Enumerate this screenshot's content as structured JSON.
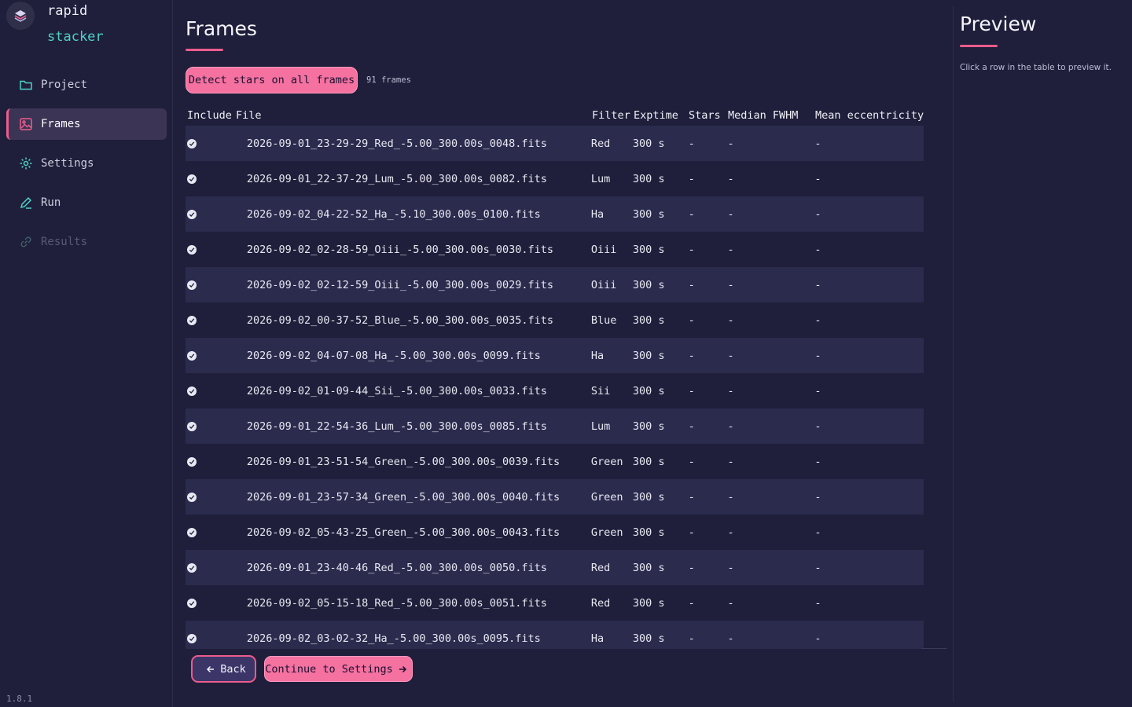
{
  "brand": {
    "line1": "rapid",
    "line2": "stacker"
  },
  "nav": [
    {
      "label": "Project",
      "icon": "folder-icon",
      "state": "normal"
    },
    {
      "label": "Frames",
      "icon": "image-icon",
      "state": "active"
    },
    {
      "label": "Settings",
      "icon": "gear-icon",
      "state": "normal"
    },
    {
      "label": "Run",
      "icon": "pen-icon",
      "state": "normal"
    },
    {
      "label": "Results",
      "icon": "link-icon",
      "state": "disabled"
    }
  ],
  "version": "1.8.1",
  "page": {
    "title": "Frames",
    "detect_label": "Detect stars on all frames",
    "frame_count": "91 frames"
  },
  "table": {
    "headers": [
      "Include",
      "File",
      "Filter",
      "Exptime",
      "Stars",
      "Median FWHM",
      "Mean eccentricity"
    ],
    "rows": [
      {
        "file": "2026-09-01_23-29-29_Red_-5.00_300.00s_0048.fits",
        "filter": "Red",
        "exptime": "300 s",
        "stars": "-",
        "fwhm": "-",
        "ecc": "-"
      },
      {
        "file": "2026-09-01_22-37-29_Lum_-5.00_300.00s_0082.fits",
        "filter": "Lum",
        "exptime": "300 s",
        "stars": "-",
        "fwhm": "-",
        "ecc": "-"
      },
      {
        "file": "2026-09-02_04-22-52_Ha_-5.10_300.00s_0100.fits",
        "filter": "Ha",
        "exptime": "300 s",
        "stars": "-",
        "fwhm": "-",
        "ecc": "-"
      },
      {
        "file": "2026-09-02_02-28-59_Oiii_-5.00_300.00s_0030.fits",
        "filter": "Oiii",
        "exptime": "300 s",
        "stars": "-",
        "fwhm": "-",
        "ecc": "-"
      },
      {
        "file": "2026-09-02_02-12-59_Oiii_-5.00_300.00s_0029.fits",
        "filter": "Oiii",
        "exptime": "300 s",
        "stars": "-",
        "fwhm": "-",
        "ecc": "-"
      },
      {
        "file": "2026-09-02_00-37-52_Blue_-5.00_300.00s_0035.fits",
        "filter": "Blue",
        "exptime": "300 s",
        "stars": "-",
        "fwhm": "-",
        "ecc": "-"
      },
      {
        "file": "2026-09-02_04-07-08_Ha_-5.00_300.00s_0099.fits",
        "filter": "Ha",
        "exptime": "300 s",
        "stars": "-",
        "fwhm": "-",
        "ecc": "-"
      },
      {
        "file": "2026-09-02_01-09-44_Sii_-5.00_300.00s_0033.fits",
        "filter": "Sii",
        "exptime": "300 s",
        "stars": "-",
        "fwhm": "-",
        "ecc": "-"
      },
      {
        "file": "2026-09-01_22-54-36_Lum_-5.00_300.00s_0085.fits",
        "filter": "Lum",
        "exptime": "300 s",
        "stars": "-",
        "fwhm": "-",
        "ecc": "-"
      },
      {
        "file": "2026-09-01_23-51-54_Green_-5.00_300.00s_0039.fits",
        "filter": "Green",
        "exptime": "300 s",
        "stars": "-",
        "fwhm": "-",
        "ecc": "-"
      },
      {
        "file": "2026-09-01_23-57-34_Green_-5.00_300.00s_0040.fits",
        "filter": "Green",
        "exptime": "300 s",
        "stars": "-",
        "fwhm": "-",
        "ecc": "-"
      },
      {
        "file": "2026-09-02_05-43-25_Green_-5.00_300.00s_0043.fits",
        "filter": "Green",
        "exptime": "300 s",
        "stars": "-",
        "fwhm": "-",
        "ecc": "-"
      },
      {
        "file": "2026-09-01_23-40-46_Red_-5.00_300.00s_0050.fits",
        "filter": "Red",
        "exptime": "300 s",
        "stars": "-",
        "fwhm": "-",
        "ecc": "-"
      },
      {
        "file": "2026-09-02_05-15-18_Red_-5.00_300.00s_0051.fits",
        "filter": "Red",
        "exptime": "300 s",
        "stars": "-",
        "fwhm": "-",
        "ecc": "-"
      },
      {
        "file": "2026-09-02_03-02-32_Ha_-5.00_300.00s_0095.fits",
        "filter": "Ha",
        "exptime": "300 s",
        "stars": "-",
        "fwhm": "-",
        "ecc": "-"
      }
    ]
  },
  "actions": {
    "back_label": "Back",
    "continue_label": "Continue to Settings"
  },
  "preview": {
    "title": "Preview",
    "hint": "Click a row in the table to preview it."
  },
  "colors": {
    "accent": "#ec5c8c",
    "accent_fill": "#f471a0",
    "brand_teal": "#4fd1c5",
    "background": "#1f1f3b",
    "row_stripe": "#2a2b4d"
  }
}
